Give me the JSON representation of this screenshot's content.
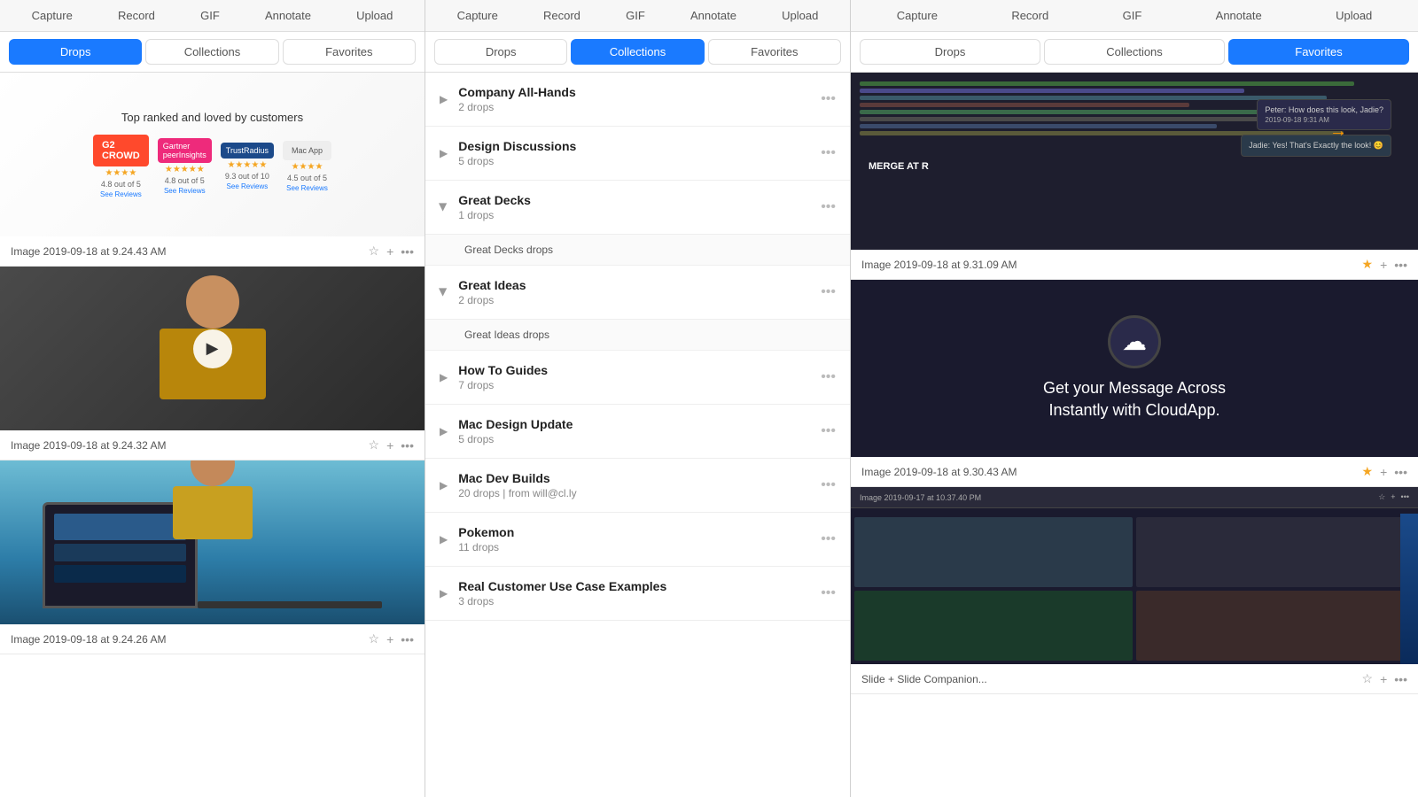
{
  "panels": [
    {
      "id": "panel-drops",
      "nav": [
        "Capture",
        "Record",
        "GIF",
        "Annotate",
        "Upload"
      ],
      "tabs": [
        {
          "label": "Drops",
          "active": true
        },
        {
          "label": "Collections",
          "active": false
        },
        {
          "label": "Favorites",
          "active": false
        }
      ],
      "items": [
        {
          "type": "image-review",
          "title": "Top ranked and loved by customers",
          "logos": [
            "G2 Crowd",
            "Gartner PeerInsights",
            "TrustRadius",
            "Mac App"
          ],
          "timestamp": "Image 2019-09-18 at 9.24.43 AM",
          "starred": false
        },
        {
          "type": "video",
          "timestamp": "Image 2019-09-18 at 9.24.32 AM",
          "starred": false
        },
        {
          "type": "woman-image",
          "timestamp": "Image 2019-09-18 at 9.24.26 AM",
          "starred": false
        }
      ]
    },
    {
      "id": "panel-collections",
      "nav": [
        "Capture",
        "Record",
        "GIF",
        "Annotate",
        "Upload"
      ],
      "tabs": [
        {
          "label": "Drops",
          "active": false
        },
        {
          "label": "Collections",
          "active": true
        },
        {
          "label": "Favorites",
          "active": false
        }
      ],
      "collections": [
        {
          "name": "Company All-Hands",
          "drops": "2 drops",
          "expanded": false
        },
        {
          "name": "Design Discussions",
          "drops": "5 drops",
          "expanded": false
        },
        {
          "name": "Great Decks",
          "drops": "1 drops",
          "expanded": true,
          "drop_items": [
            "Great Decks drops"
          ]
        },
        {
          "name": "Great Ideas",
          "drops": "2 drops",
          "expanded": true,
          "drop_items": [
            "Great Ideas drops"
          ]
        },
        {
          "name": "How To Guides",
          "drops": "7 drops",
          "expanded": false
        },
        {
          "name": "Mac Design Update",
          "drops": "5 drops",
          "expanded": false
        },
        {
          "name": "Mac Dev Builds",
          "drops": "20 drops | from will@cl.ly",
          "expanded": false
        },
        {
          "name": "Pokemon",
          "drops": "11 drops",
          "expanded": false
        },
        {
          "name": "Real Customer Use Case Examples",
          "drops": "3 drops",
          "expanded": false
        }
      ]
    },
    {
      "id": "panel-favorites",
      "nav": [
        "Capture",
        "Record",
        "GIF",
        "Annotate",
        "Upload"
      ],
      "tabs": [
        {
          "label": "Drops",
          "active": false
        },
        {
          "label": "Collections",
          "active": false
        },
        {
          "label": "Favorites",
          "active": true
        }
      ],
      "items": [
        {
          "type": "code-screenshot",
          "timestamp": "Image 2019-09-18 at 9.31.09 AM",
          "starred": true
        },
        {
          "type": "cloudapp-ad",
          "text": "Get your Message Across Instantly with CloudApp.",
          "timestamp": "Image 2019-09-18 at 9.30.43 AM",
          "starred": true
        },
        {
          "type": "screen-recording",
          "timestamp": "Slide + Slide Companion...",
          "starred": false
        }
      ]
    }
  ],
  "icons": {
    "chevron_right": "▶",
    "more": "•••",
    "star_empty": "☆",
    "star_filled": "★",
    "plus": "+",
    "play": "▶",
    "cloud": "☁"
  }
}
